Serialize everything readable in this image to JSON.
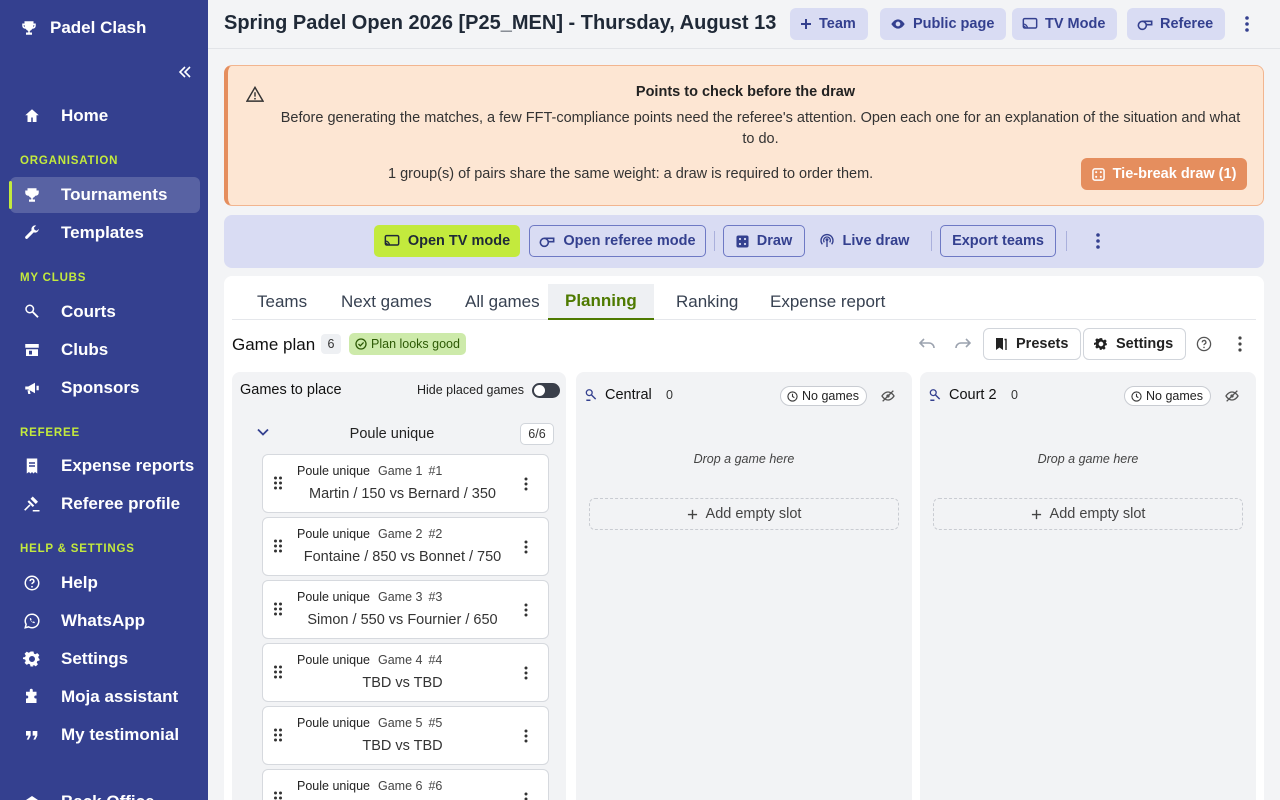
{
  "brand": {
    "name": "Padel Clash"
  },
  "sidebar": {
    "home": "Home",
    "sections": {
      "organisation": "ORGANISATION",
      "my_clubs": "MY CLUBS",
      "referee": "REFEREE",
      "help_settings": "HELP & SETTINGS"
    },
    "items": {
      "tournaments": "Tournaments",
      "templates": "Templates",
      "courts": "Courts",
      "clubs": "Clubs",
      "sponsors": "Sponsors",
      "expense_reports": "Expense reports",
      "referee_profile": "Referee profile",
      "help": "Help",
      "whatsapp": "WhatsApp",
      "settings": "Settings",
      "moja_assistant": "Moja assistant",
      "my_testimonial": "My testimonial",
      "back_office": "Back Office"
    },
    "active": "tournaments"
  },
  "header": {
    "title": "Spring Padel Open 2026 [P25_MEN] - Thursday, August 13",
    "buttons": {
      "team": "Team",
      "public_page": "Public page",
      "tv_mode": "TV Mode",
      "referee": "Referee"
    }
  },
  "alert": {
    "title": "Points to check before the draw",
    "description": "Before generating the matches, a few FFT-compliance points need the referee's attention. Open each one for an explanation of the situation and what to do.",
    "note": "1 group(s) of pairs share the same weight: a draw is required to order them.",
    "action": "Tie-break draw (1)"
  },
  "actions": {
    "open_tv_mode": "Open TV mode",
    "open_referee_mode": "Open referee mode",
    "draw": "Draw",
    "live_draw": "Live draw",
    "export_teams": "Export teams"
  },
  "tabs": {
    "items": [
      "Teams",
      "Next games",
      "All games",
      "Planning",
      "Ranking",
      "Expense report"
    ],
    "active": "Planning"
  },
  "plan": {
    "title": "Game plan",
    "count": "6",
    "status": "Plan looks good",
    "presets": "Presets",
    "settings": "Settings"
  },
  "games_panel": {
    "title": "Games to place",
    "hide_placed_label": "Hide placed games",
    "hide_placed_on": false,
    "group": {
      "name": "Poule unique",
      "count": "6/6"
    },
    "games": [
      {
        "group": "Poule unique",
        "game": "Game 1",
        "id": "#1",
        "teams": "Martin / 150 vs Bernard / 350"
      },
      {
        "group": "Poule unique",
        "game": "Game 2",
        "id": "#2",
        "teams": "Fontaine / 850 vs Bonnet / 750"
      },
      {
        "group": "Poule unique",
        "game": "Game 3",
        "id": "#3",
        "teams": "Simon / 550 vs Fournier / 650"
      },
      {
        "group": "Poule unique",
        "game": "Game 4",
        "id": "#4",
        "teams": "TBD vs TBD"
      },
      {
        "group": "Poule unique",
        "game": "Game 5",
        "id": "#5",
        "teams": "TBD vs TBD"
      },
      {
        "group": "Poule unique",
        "game": "Game 6",
        "id": "#6",
        "teams": ""
      }
    ]
  },
  "courts": [
    {
      "name": "Central",
      "count": "0",
      "status": "No games",
      "drop_hint": "Drop a game here",
      "add_slot": "Add empty slot"
    },
    {
      "name": "Court 2",
      "count": "0",
      "status": "No games",
      "drop_hint": "Drop a game here",
      "add_slot": "Add empty slot"
    }
  ],
  "colors": {
    "sidebar": "#34408f",
    "accent_lime": "#c3ea3d",
    "alert_bg": "#fde6d3",
    "alert_action": "#e58e5e",
    "action_bar": "#d9dcf3",
    "active_tab": "#4e7a00",
    "status_ok": "#cdeaaa"
  },
  "icons": {
    "brand": "trophy-icon",
    "home": "home-icon",
    "tournaments": "trophy-icon",
    "templates": "wrench-icon",
    "courts": "court-icon",
    "clubs": "store-icon",
    "sponsors": "megaphone-icon",
    "expense_reports": "receipt-icon",
    "referee_profile": "gavel-icon",
    "help": "help-circle-icon",
    "whatsapp": "whatsapp-icon",
    "settings": "gear-icon",
    "moja_assistant": "puzzle-icon",
    "my_testimonial": "quote-icon"
  }
}
